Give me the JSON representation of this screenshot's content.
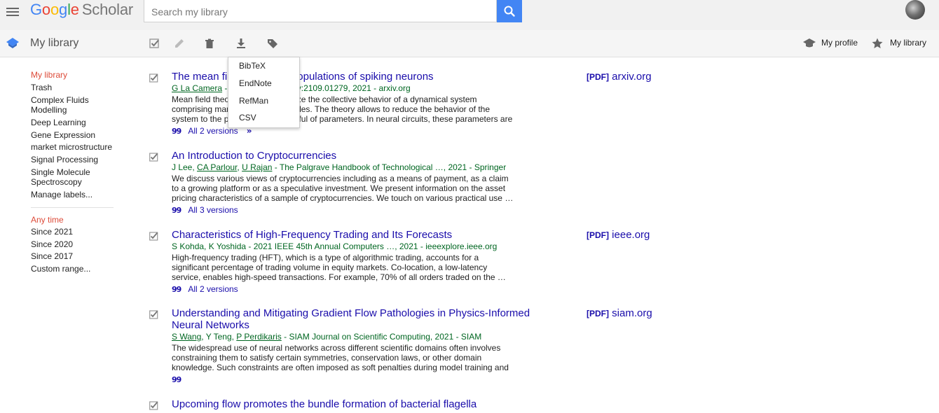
{
  "header": {
    "logo": {
      "google_letters": [
        "G",
        "o",
        "o",
        "g",
        "l",
        "e"
      ],
      "scholar": "Scholar"
    },
    "search": {
      "placeholder": "Search my library",
      "value": ""
    }
  },
  "subbar": {
    "title": "My library",
    "my_profile": "My profile",
    "my_library": "My library"
  },
  "export_menu": {
    "items": [
      "BibTeX",
      "EndNote",
      "RefMan",
      "CSV"
    ]
  },
  "sidebar": {
    "labels": [
      "My library",
      "Trash",
      "Complex Fluids Modelling",
      "Deep Learning",
      "Gene Expression",
      "market microstructure",
      "Signal Processing",
      "Single Molecule Spectroscopy",
      "Manage labels..."
    ],
    "time": [
      "Any time",
      "Since 2021",
      "Since 2020",
      "Since 2017",
      "Custom range..."
    ]
  },
  "results": [
    {
      "title": "The mean field theory for populations of spiking neurons",
      "authors_link": "G La Camera",
      "meta_rest": " - arXiv preprint arXiv:2109.01279, 2021 - arxiv.org",
      "snippet": "Mean field theory is used to analyze the collective behavior of a dynamical system comprising many interacting particles. The theory allows to reduce the behavior of the system to the properties of a handful of parameters. In neural circuits, these parameters are …",
      "versions": "All 2 versions",
      "pdf_tag": "[PDF]",
      "pdf_source": "arxiv.org"
    },
    {
      "title": "An Introduction to Cryptocurrencies",
      "authors_plain": "J Lee, ",
      "authors_link": "CA Parlour",
      "authors_link2": "U Rajan",
      "meta_rest": " - The Palgrave Handbook of Technological …, 2021 - Springer",
      "snippet": "We discuss various views of cryptocurrencies including as a means of payment, as a claim to a growing platform or as a speculative investment. We present information on the asset pricing characteristics of a sample of cryptocurrencies. We touch on various practical use …",
      "versions": "All 3 versions"
    },
    {
      "title": "Characteristics of High-Frequency Trading and Its Forecasts",
      "meta": "S Kohda, K Yoshida - 2021 IEEE 45th Annual Computers …, 2021 - ieeexplore.ieee.org",
      "snippet": "High-frequency trading (HFT), which is a type of algorithmic trading, accounts for a significant percentage of trading volume in equity markets. Co-location, a low-latency service, enables high-speed transactions. For example, 70% of all orders traded on the …",
      "versions": "All 2 versions",
      "pdf_tag": "[PDF]",
      "pdf_source": "ieee.org"
    },
    {
      "title": "Understanding and Mitigating Gradient Flow Pathologies in Physics-Informed Neural Networks",
      "authors_link": "S Wang",
      "authors_plain": ", Y Teng, ",
      "authors_link2": "P Perdikaris",
      "meta_rest": " - SIAM Journal on Scientific Computing, 2021 - SIAM",
      "snippet": "The widespread use of neural networks across different scientific domains often involves constraining them to satisfy certain symmetries, conservation laws, or other domain knowledge. Such constraints are often imposed as soft penalties during model training and …",
      "pdf_tag": "[PDF]",
      "pdf_source": "siam.org"
    },
    {
      "title": "Upcoming flow promotes the bundle formation of bacterial flagella"
    }
  ],
  "colors": {
    "link": "#1a0dab",
    "meta_green": "#006621",
    "active_red": "#dd4b39",
    "search_blue": "#4285f4"
  },
  "icons": [
    "menu-icon",
    "search-icon",
    "avatar",
    "library-icon",
    "select-all-checkbox",
    "edit-icon",
    "delete-icon",
    "export-icon",
    "label-icon",
    "graduation-cap-icon",
    "star-icon",
    "cite-icon",
    "related-articles-icon"
  ]
}
